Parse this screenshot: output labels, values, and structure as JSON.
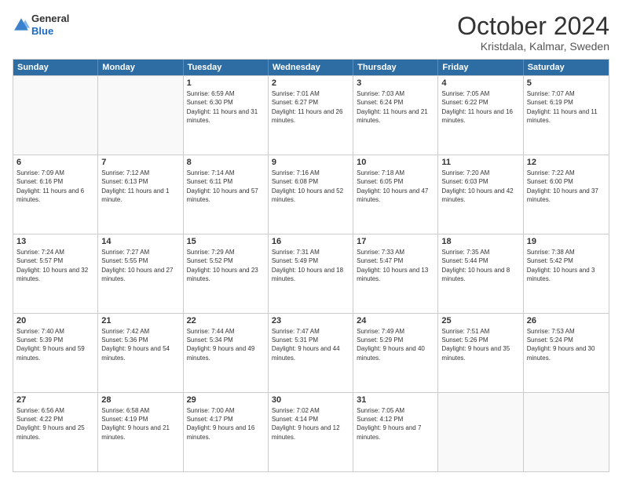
{
  "logo": {
    "general": "General",
    "blue": "Blue"
  },
  "header": {
    "month": "October 2024",
    "location": "Kristdala, Kalmar, Sweden"
  },
  "days_of_week": [
    "Sunday",
    "Monday",
    "Tuesday",
    "Wednesday",
    "Thursday",
    "Friday",
    "Saturday"
  ],
  "weeks": [
    [
      {
        "day": "",
        "text": ""
      },
      {
        "day": "",
        "text": ""
      },
      {
        "day": "1",
        "text": "Sunrise: 6:59 AM\nSunset: 6:30 PM\nDaylight: 11 hours and 31 minutes."
      },
      {
        "day": "2",
        "text": "Sunrise: 7:01 AM\nSunset: 6:27 PM\nDaylight: 11 hours and 26 minutes."
      },
      {
        "day": "3",
        "text": "Sunrise: 7:03 AM\nSunset: 6:24 PM\nDaylight: 11 hours and 21 minutes."
      },
      {
        "day": "4",
        "text": "Sunrise: 7:05 AM\nSunset: 6:22 PM\nDaylight: 11 hours and 16 minutes."
      },
      {
        "day": "5",
        "text": "Sunrise: 7:07 AM\nSunset: 6:19 PM\nDaylight: 11 hours and 11 minutes."
      }
    ],
    [
      {
        "day": "6",
        "text": "Sunrise: 7:09 AM\nSunset: 6:16 PM\nDaylight: 11 hours and 6 minutes."
      },
      {
        "day": "7",
        "text": "Sunrise: 7:12 AM\nSunset: 6:13 PM\nDaylight: 11 hours and 1 minute."
      },
      {
        "day": "8",
        "text": "Sunrise: 7:14 AM\nSunset: 6:11 PM\nDaylight: 10 hours and 57 minutes."
      },
      {
        "day": "9",
        "text": "Sunrise: 7:16 AM\nSunset: 6:08 PM\nDaylight: 10 hours and 52 minutes."
      },
      {
        "day": "10",
        "text": "Sunrise: 7:18 AM\nSunset: 6:05 PM\nDaylight: 10 hours and 47 minutes."
      },
      {
        "day": "11",
        "text": "Sunrise: 7:20 AM\nSunset: 6:03 PM\nDaylight: 10 hours and 42 minutes."
      },
      {
        "day": "12",
        "text": "Sunrise: 7:22 AM\nSunset: 6:00 PM\nDaylight: 10 hours and 37 minutes."
      }
    ],
    [
      {
        "day": "13",
        "text": "Sunrise: 7:24 AM\nSunset: 5:57 PM\nDaylight: 10 hours and 32 minutes."
      },
      {
        "day": "14",
        "text": "Sunrise: 7:27 AM\nSunset: 5:55 PM\nDaylight: 10 hours and 27 minutes."
      },
      {
        "day": "15",
        "text": "Sunrise: 7:29 AM\nSunset: 5:52 PM\nDaylight: 10 hours and 23 minutes."
      },
      {
        "day": "16",
        "text": "Sunrise: 7:31 AM\nSunset: 5:49 PM\nDaylight: 10 hours and 18 minutes."
      },
      {
        "day": "17",
        "text": "Sunrise: 7:33 AM\nSunset: 5:47 PM\nDaylight: 10 hours and 13 minutes."
      },
      {
        "day": "18",
        "text": "Sunrise: 7:35 AM\nSunset: 5:44 PM\nDaylight: 10 hours and 8 minutes."
      },
      {
        "day": "19",
        "text": "Sunrise: 7:38 AM\nSunset: 5:42 PM\nDaylight: 10 hours and 3 minutes."
      }
    ],
    [
      {
        "day": "20",
        "text": "Sunrise: 7:40 AM\nSunset: 5:39 PM\nDaylight: 9 hours and 59 minutes."
      },
      {
        "day": "21",
        "text": "Sunrise: 7:42 AM\nSunset: 5:36 PM\nDaylight: 9 hours and 54 minutes."
      },
      {
        "day": "22",
        "text": "Sunrise: 7:44 AM\nSunset: 5:34 PM\nDaylight: 9 hours and 49 minutes."
      },
      {
        "day": "23",
        "text": "Sunrise: 7:47 AM\nSunset: 5:31 PM\nDaylight: 9 hours and 44 minutes."
      },
      {
        "day": "24",
        "text": "Sunrise: 7:49 AM\nSunset: 5:29 PM\nDaylight: 9 hours and 40 minutes."
      },
      {
        "day": "25",
        "text": "Sunrise: 7:51 AM\nSunset: 5:26 PM\nDaylight: 9 hours and 35 minutes."
      },
      {
        "day": "26",
        "text": "Sunrise: 7:53 AM\nSunset: 5:24 PM\nDaylight: 9 hours and 30 minutes."
      }
    ],
    [
      {
        "day": "27",
        "text": "Sunrise: 6:56 AM\nSunset: 4:22 PM\nDaylight: 9 hours and 25 minutes."
      },
      {
        "day": "28",
        "text": "Sunrise: 6:58 AM\nSunset: 4:19 PM\nDaylight: 9 hours and 21 minutes."
      },
      {
        "day": "29",
        "text": "Sunrise: 7:00 AM\nSunset: 4:17 PM\nDaylight: 9 hours and 16 minutes."
      },
      {
        "day": "30",
        "text": "Sunrise: 7:02 AM\nSunset: 4:14 PM\nDaylight: 9 hours and 12 minutes."
      },
      {
        "day": "31",
        "text": "Sunrise: 7:05 AM\nSunset: 4:12 PM\nDaylight: 9 hours and 7 minutes."
      },
      {
        "day": "",
        "text": ""
      },
      {
        "day": "",
        "text": ""
      }
    ]
  ]
}
